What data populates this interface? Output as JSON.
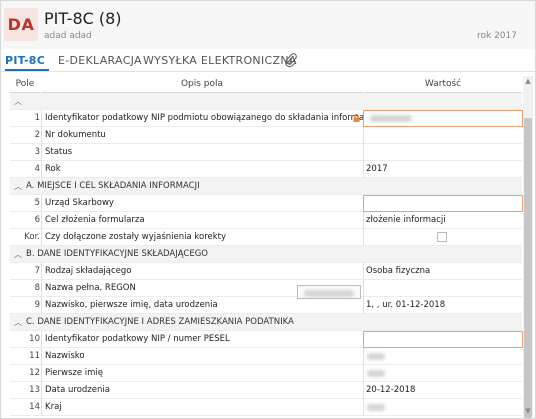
{
  "header": {
    "badge": "DA",
    "title": "PIT-8C (8)",
    "subtitle": "adad adad",
    "year_label": "rok 2017"
  },
  "tabs": [
    {
      "label": "PIT-8C",
      "active": true
    },
    {
      "label": "E-DEKLARACJA",
      "active": false
    },
    {
      "label": "WYSYŁKA ELEKTRONICZNA",
      "active": false
    }
  ],
  "grid": {
    "columns": {
      "pole": "Pole",
      "opis": "Opis pola",
      "wartosc": "Wartość"
    },
    "rows": [
      {
        "type": "section",
        "label": ""
      },
      {
        "type": "field",
        "num": "1",
        "desc": "Identyfikator podatkowy NIP podmiotu obowiązanego do składania informacji",
        "value": "",
        "locked": true,
        "input": true,
        "blurred": true
      },
      {
        "type": "field",
        "num": "2",
        "desc": "Nr dokumentu",
        "value": ""
      },
      {
        "type": "field",
        "num": "3",
        "desc": "Status",
        "value": ""
      },
      {
        "type": "field",
        "num": "4",
        "desc": "Rok",
        "value": "2017"
      },
      {
        "type": "section",
        "label": "A. MIEJSCE I CEL SKŁADANIA INFORMACJI"
      },
      {
        "type": "field",
        "num": "5",
        "desc": "Urząd Skarbowy",
        "value": "",
        "input": true
      },
      {
        "type": "field",
        "num": "6",
        "desc": "Cel złożenia formularza",
        "value": "złożenie informacji"
      },
      {
        "type": "field",
        "num": "Kor.",
        "desc": "Czy dołączone zostały wyjaśnienia korekty",
        "value": "",
        "checkbox": true
      },
      {
        "type": "section",
        "label": "B. DANE IDENTYFIKACYJNE SKŁADAJĄCEGO"
      },
      {
        "type": "field",
        "num": "7",
        "desc": "Rodzaj składającego",
        "value": "Osoba fizyczna"
      },
      {
        "type": "field",
        "num": "8",
        "desc": "Nazwa pełna, REGON",
        "value": ""
      },
      {
        "type": "field",
        "num": "9",
        "desc": "Nazwisko, pierwsze imię, data urodzenia",
        "value": "1, , ur. 01-12-2018"
      },
      {
        "type": "section",
        "label": "C. DANE IDENTYFIKACYJNE I ADRES ZAMIESZKANIA PODATNIKA"
      },
      {
        "type": "field",
        "num": "10",
        "desc": "Identyfikator podatkowy NIP / numer PESEL",
        "value": "",
        "input": true
      },
      {
        "type": "field",
        "num": "11",
        "desc": "Nazwisko",
        "value": "",
        "blurred": true
      },
      {
        "type": "field",
        "num": "12",
        "desc": "Pierwsze imię",
        "value": "",
        "blurred": true
      },
      {
        "type": "field",
        "num": "13",
        "desc": "Data urodzenia",
        "value": "20-12-2018"
      },
      {
        "type": "field",
        "num": "14",
        "desc": "Kraj",
        "value": "",
        "blurred": true
      }
    ]
  },
  "colors": {
    "accent": "#1f6fb8",
    "badge_text": "#b4372d",
    "badge_bg": "#f6e4e0",
    "input_border": "#f0a070",
    "lock": "#e8883a"
  }
}
